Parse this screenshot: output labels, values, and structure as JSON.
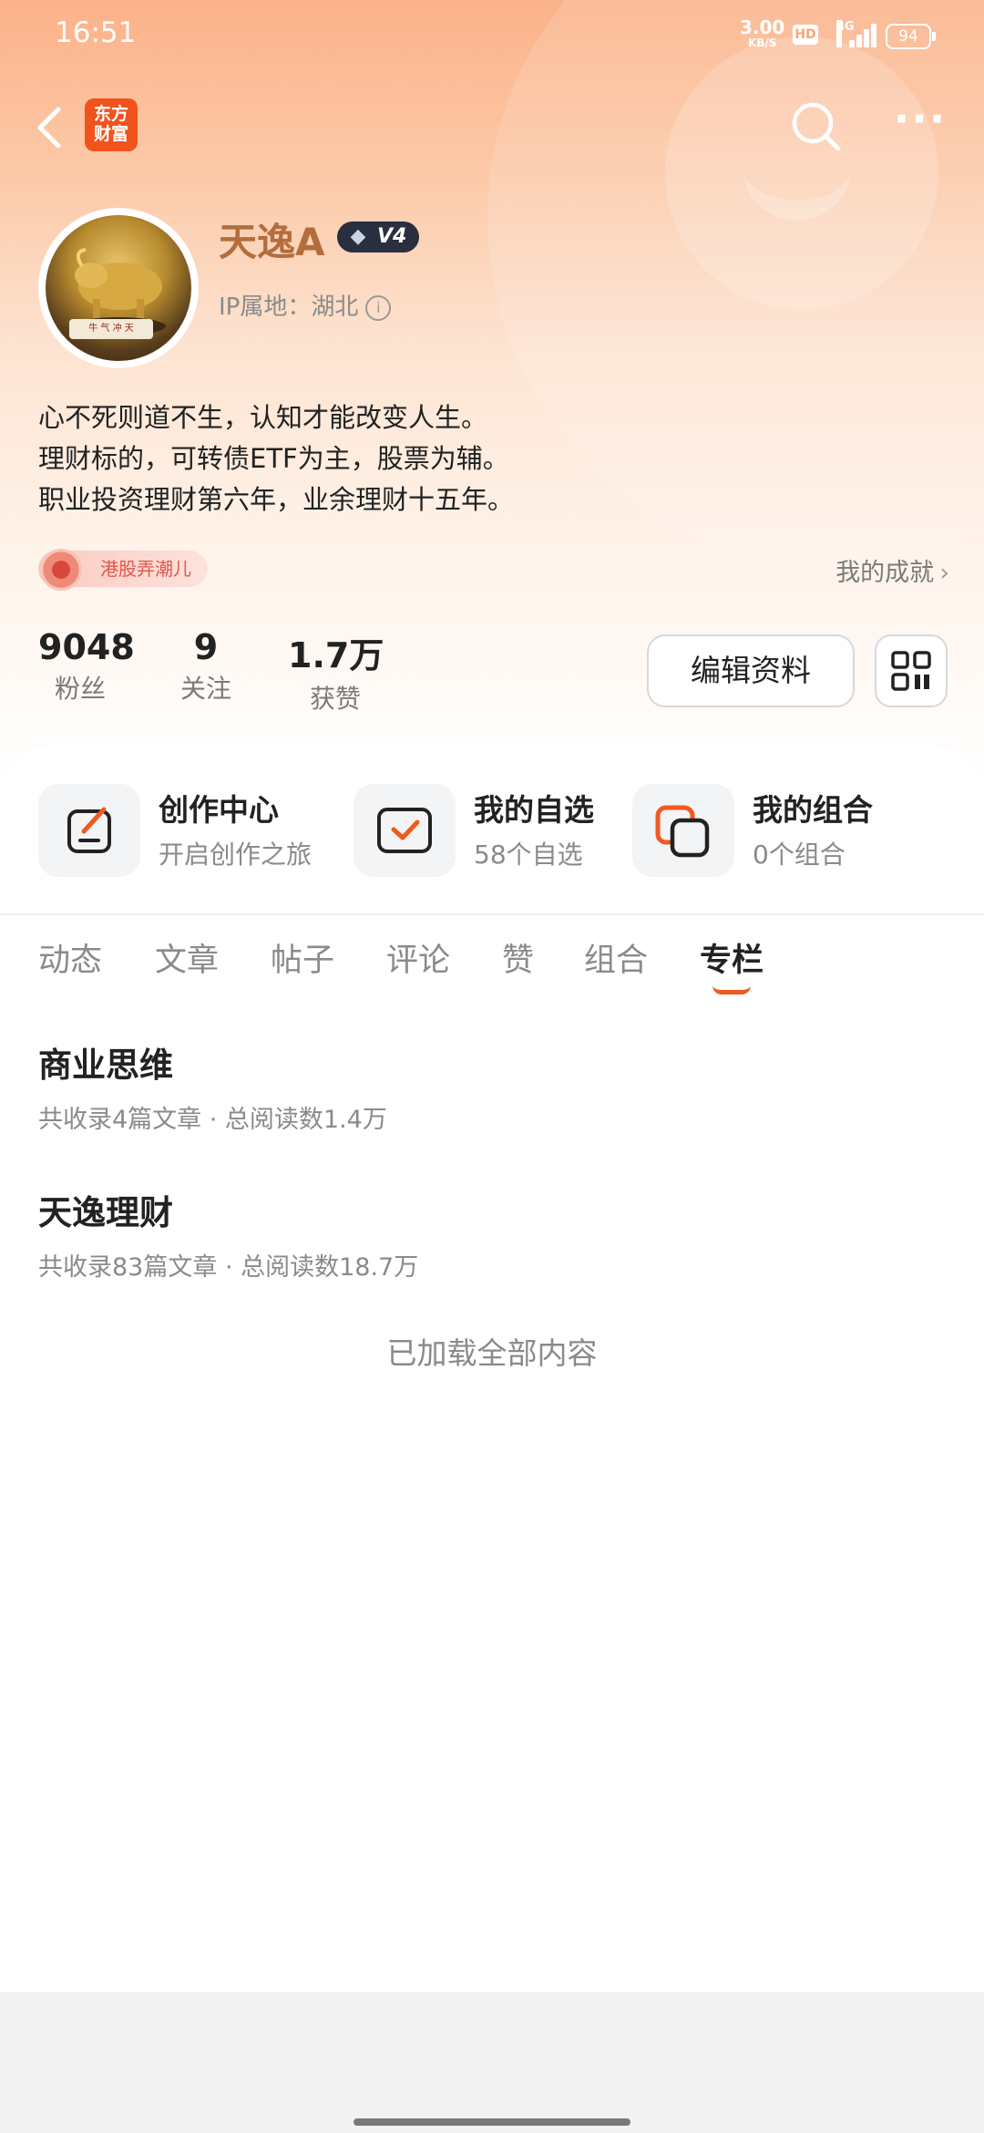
{
  "status_bar": {
    "time": "16:51",
    "net_speed": "3.00",
    "net_unit": "KB/S",
    "hd": "HD",
    "network": "4G",
    "battery": "94"
  },
  "nav": {
    "logo_line1": "东方",
    "logo_line2": "财富"
  },
  "profile": {
    "username": "天逸A",
    "level": "V4",
    "ip_location": "IP属地：湖北",
    "bio": [
      "心不死则道不生，认知才能改变人生。",
      "理财标的，可转债ETF为主，股票为辅。",
      "职业投资理财第六年，业余理财十五年。"
    ],
    "tag": "港股弄潮儿",
    "achievements": "我的成就",
    "stats": [
      {
        "value": "9048",
        "label": "粉丝"
      },
      {
        "value": "9",
        "label": "关注"
      },
      {
        "value": "1.7万",
        "label": "获赞"
      }
    ],
    "edit_button": "编辑资料"
  },
  "quick_actions": [
    {
      "title": "创作中心",
      "subtitle": "开启创作之旅",
      "icon": "create-icon"
    },
    {
      "title": "我的自选",
      "subtitle": "58个自选",
      "icon": "watchlist-icon"
    },
    {
      "title": "我的组合",
      "subtitle": "0个组合",
      "icon": "portfolio-icon"
    }
  ],
  "tabs": [
    "动态",
    "文章",
    "帖子",
    "评论",
    "赞",
    "组合",
    "专栏"
  ],
  "active_tab": "专栏",
  "columns": [
    {
      "title": "商业思维",
      "meta": "共收录4篇文章 · 总阅读数1.4万"
    },
    {
      "title": "天逸理财",
      "meta": "共收录83篇文章 · 总阅读数18.7万"
    }
  ],
  "footer_text": "已加载全部内容",
  "colors": {
    "accent": "#f05a1f",
    "username": "#b36d3d",
    "header_gradient_top": "#fbb289"
  }
}
